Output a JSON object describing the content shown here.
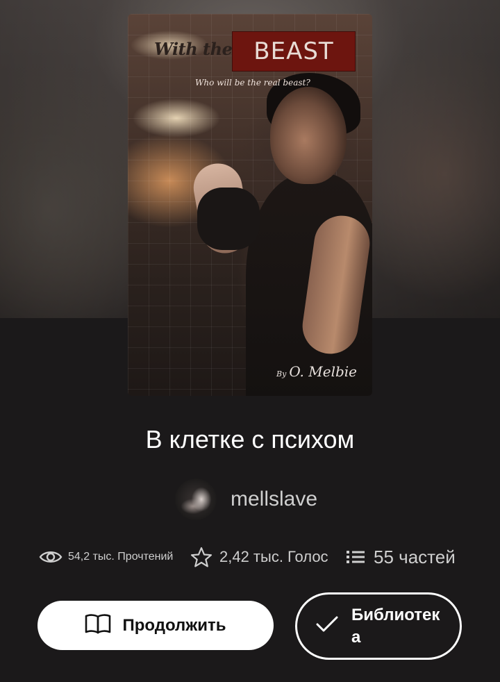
{
  "cover": {
    "title_part1": "With the",
    "title_part2": "BEAST",
    "tagline": "Who will be the real beast?",
    "author_prefix": "By",
    "author_name": "O. Melbie"
  },
  "book": {
    "title": "В клетке с психом"
  },
  "author": {
    "username": "mellslave"
  },
  "stats": {
    "reads": "54,2 тыс. Прочтений",
    "reads_icon": "eye-icon",
    "votes": "2,42 тыс. Голос",
    "votes_icon": "star-icon",
    "parts": "55 частей",
    "parts_icon": "list-icon"
  },
  "actions": {
    "continue_label": "Продолжить",
    "continue_icon": "open-book-icon",
    "library_label": "Библиотека",
    "library_icon": "checkmark-icon"
  }
}
